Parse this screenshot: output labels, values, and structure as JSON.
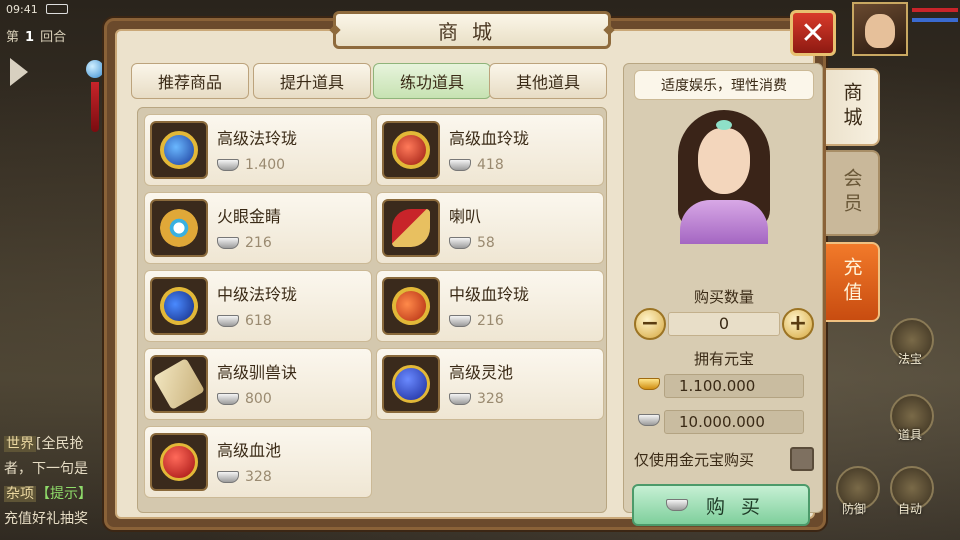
{
  "status": {
    "time": "09:41"
  },
  "battle": {
    "round_prefix": "第",
    "round_number": "1",
    "round_suffix": "回合"
  },
  "chat": {
    "lines": [
      {
        "tag": "世界",
        "text": "[全民抢"
      },
      {
        "tag": "",
        "text": "者，下一句是"
      },
      {
        "tag": "杂项",
        "text": "【提示】"
      },
      {
        "tag": "",
        "text": "充值好礼抽奖"
      }
    ]
  },
  "side_buttons": {
    "fabao": "法宝",
    "equip": "道具",
    "defend": "防御",
    "auto": "自动"
  },
  "shop": {
    "title": "商城",
    "tabs": [
      "推荐商品",
      "提升道具",
      "练功道具",
      "其他道具"
    ],
    "active_tab": "练功道具",
    "items": [
      {
        "name": "高级法玲珑",
        "price": "1.400",
        "icon": "fa-linglong-icon"
      },
      {
        "name": "高级血玲珑",
        "price": "418",
        "icon": "xue-linglong-icon"
      },
      {
        "name": "火眼金睛",
        "price": "216",
        "icon": "golden-eye-icon"
      },
      {
        "name": "喇叭",
        "price": "58",
        "icon": "horn-icon"
      },
      {
        "name": "中级法玲珑",
        "price": "618",
        "icon": "mid-fa-linglong-icon"
      },
      {
        "name": "中级血玲珑",
        "price": "216",
        "icon": "mid-xue-linglong-icon"
      },
      {
        "name": "高级驯兽诀",
        "price": "800",
        "icon": "scroll-icon"
      },
      {
        "name": "高级灵池",
        "price": "328",
        "icon": "blue-pool-icon"
      },
      {
        "name": "高级血池",
        "price": "328",
        "icon": "red-pool-icon"
      }
    ],
    "slogan": "适度娱乐，理性消费",
    "quantity_label": "购买数量",
    "quantity_value": "0",
    "owned_label": "拥有元宝",
    "gold_yuanbao": "1.100.000",
    "silver_yuanbao": "10.000.000",
    "gold_only_label": "仅使用金元宝购买",
    "buy_label": "购买",
    "close_symbol": "✕",
    "side_tabs": {
      "shop": "商城",
      "vip": "会员",
      "recharge": "充值"
    }
  },
  "colors": {
    "accent_red": "#c8242a",
    "buy_green": "#7fcf9c",
    "recharge_orange": "#e2651c",
    "active_tab": "#c7e2b2"
  }
}
